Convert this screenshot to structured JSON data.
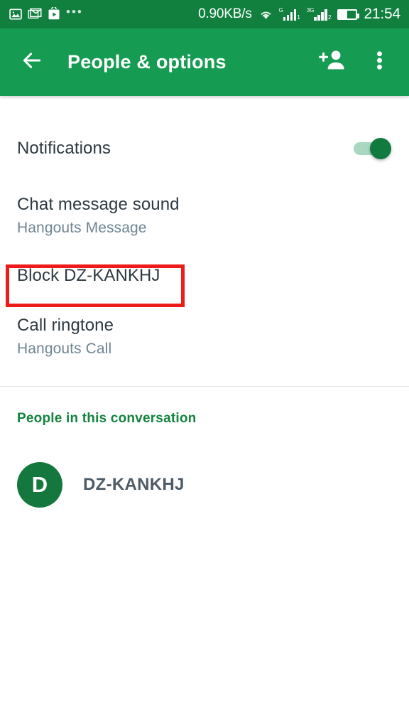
{
  "status_bar": {
    "background": "#11803f",
    "left_icons": [
      "photo-icon",
      "gmail-icon",
      "play-store-icon"
    ],
    "overflow_dots": "•••",
    "network_speed": "0.90KB/s",
    "wifi_icon": "wifi-icon",
    "sim1_network": "G",
    "sim1_label": "1",
    "sim2_network": "3G",
    "sim2_label": "2",
    "battery_icon": "battery-icon",
    "time": "21:54"
  },
  "toolbar": {
    "background": "#169b52",
    "back_icon": "back-arrow-icon",
    "title": "People & options",
    "add_person_icon": "add-person-icon",
    "overflow_icon": "overflow-menu-icon"
  },
  "settings": {
    "notifications": {
      "label": "Notifications",
      "toggle_state": "on",
      "toggle_on_color": "#117a3f",
      "toggle_track_color": "#a9d7c0"
    },
    "chat_message_sound": {
      "label": "Chat message sound",
      "value": "Hangouts Message"
    },
    "block": {
      "label": "Block DZ-KANKHJ",
      "annotation_color": "#ee1b1b",
      "annotated": "true"
    },
    "call_ringtone": {
      "label": "Call ringtone",
      "value": "Hangouts Call"
    }
  },
  "people_section": {
    "header": "People in this conversation",
    "header_color": "#12843f",
    "people": [
      {
        "avatar_initial": "D",
        "avatar_color": "#14783e",
        "name": "DZ-KANKHJ"
      }
    ]
  }
}
